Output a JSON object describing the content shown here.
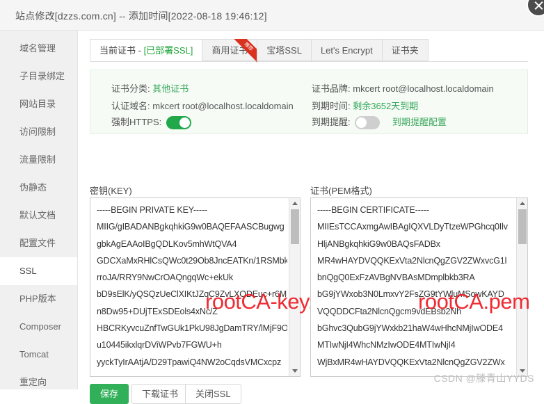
{
  "window": {
    "title": "站点修改[dzzs.com.cn] -- 添加时间[2022-08-18 19:46:12]",
    "close_label": "×"
  },
  "sidebar": {
    "items": [
      {
        "label": "域名管理",
        "active": false
      },
      {
        "label": "子目录绑定",
        "active": false
      },
      {
        "label": "网站目录",
        "active": false
      },
      {
        "label": "访问限制",
        "active": false
      },
      {
        "label": "流量限制",
        "active": false
      },
      {
        "label": "伪静态",
        "active": false
      },
      {
        "label": "默认文档",
        "active": false
      },
      {
        "label": "配置文件",
        "active": false
      },
      {
        "label": "SSL",
        "active": true
      },
      {
        "label": "PHP版本",
        "active": false
      },
      {
        "label": "Composer",
        "active": false
      },
      {
        "label": "Tomcat",
        "active": false
      },
      {
        "label": "重定向",
        "active": false
      }
    ]
  },
  "tabs": [
    {
      "label": "当前证书 - ",
      "sub": "[已部署SSL]",
      "active": true,
      "ribbon": ""
    },
    {
      "label": "商用证书",
      "sub": "",
      "active": false,
      "ribbon": "推荐"
    },
    {
      "label": "宝塔SSL",
      "sub": "",
      "active": false,
      "ribbon": ""
    },
    {
      "label": "Let's Encrypt",
      "sub": "",
      "active": false,
      "ribbon": ""
    },
    {
      "label": "证书夹",
      "sub": "",
      "active": false,
      "ribbon": ""
    }
  ],
  "cert_info": {
    "category_label": "证书分类:",
    "category_value": "其他证书",
    "brand_label": "证书品牌:",
    "brand_value": "mkcert root@localhost.localdomain",
    "domain_label": "认证域名:",
    "domain_value": "mkcert root@localhost.localdomain",
    "expire_label": "到期时间:",
    "expire_value": "剩余3652天到期",
    "force_https_label": "强制HTTPS:",
    "force_https_on": true,
    "remind_label": "到期提醒:",
    "remind_on": false,
    "remind_config_link": "到期提醒配置"
  },
  "key_panel": {
    "label": "密钥(KEY)",
    "value": "-----BEGIN PRIVATE KEY-----\nMIIG/gIBADANBgkqhkiG9w0BAQEFAASCBugwg\ngbkAgEAAoIBgQDLKov5mhWtQVA4\nGDCXaMxRHlCsQWc0t29Ob8JncEATKn/1RSMbk\nrroJA/RRY9NwCrOAQngqWc+ekUk\nbD9sElK/yQSQzUeClXIKtJZqC9ZvLXODEuc+r6M\nn8Dw95+DUjTExSDEols4xNc/Z\nHBCRKyvcuZnfTwGUk1PkU98JgDamTRY/lMjF9O\nu10445ikxlqrDViWPvb7FGWU+h\nyyckTyIrAAtjA/D29TpawiQ4NW2oCqdsVMCxcpz",
    "watermark": "rootCA-key.pem"
  },
  "pem_panel": {
    "label": "证书(PEM格式)",
    "value": "-----BEGIN CERTIFICATE-----\nMIIEsTCCAxmgAwIBAgIQXVLDyTtzeWPGhcq0Ilv\nHljANBgkqhkiG9w0BAQsFADBx\nMR4wHAYDVQQKExVta2NlcnQgZGV2ZWxvcG1l\nbnQgQ0ExFzAVBgNVBAsMDmplbkb3RA\nbG9jYWxob3N0LmxvY2FsZG9tYWluMSowKAYD\nVQQDDCFta2NlcnQgcm9vdEBsb2Nh\nbGhvc3QubG9jYWxkb21haW4wHhcNMjIwODE4\nMTIwNjI4WhcNMzIwODE4MTIwNjI4\nWjBxMR4wHAYDVQQKExVta2NlcnQgZGV2ZWx",
    "watermark": "rootCA.pem"
  },
  "footer": {
    "save": "保存",
    "download": "下载证书",
    "close_ssl": "关闭SSL",
    "watermark": "CSDN @滕青山YYDS"
  },
  "colors": {
    "accent_green": "#32b059",
    "link_green": "#3fa95f",
    "ribbon_red": "#d9321f",
    "watermark_red": "#ee1c24"
  }
}
